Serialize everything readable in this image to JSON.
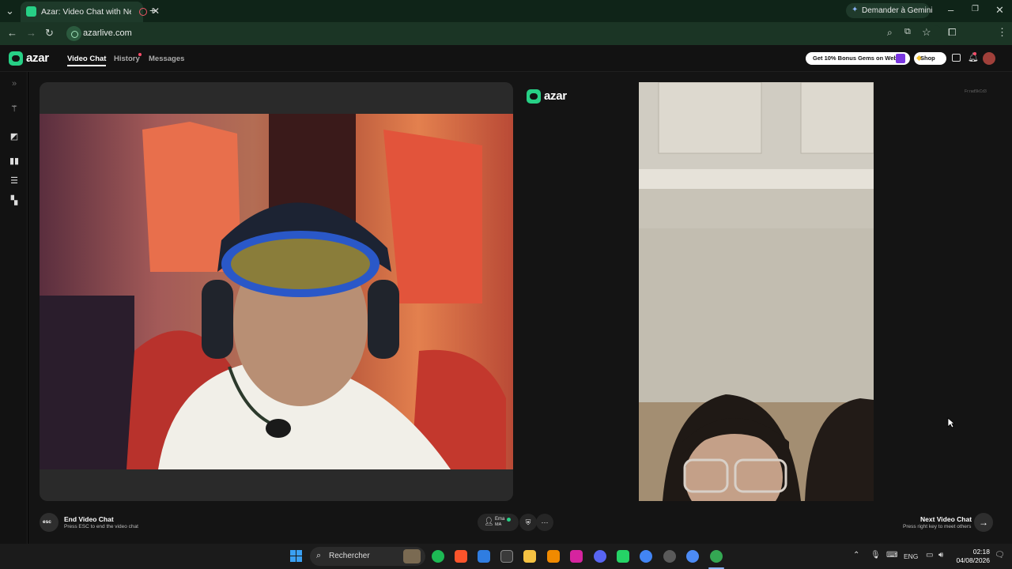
{
  "browser": {
    "tab_title": "Azar: Video Chat with New",
    "url": "azarlive.com",
    "gemini_label": "Demander à Gemini"
  },
  "azar": {
    "logo_text": "azar",
    "nav": {
      "video_chat": "Video Chat",
      "history": "History",
      "messages": "Messages"
    },
    "promo_label": "Get 10% Bonus Gems on Web!",
    "shop_label": "Shop",
    "watermark": "Fr:rad5kCd3"
  },
  "controls": {
    "esc_key": "esc",
    "end_title": "End Video Chat",
    "end_sub": "Press ESC to end the video chat",
    "partner_name": "Ema",
    "partner_country": "MA",
    "next_title": "Next Video Chat",
    "next_sub": "Press right key to meet others"
  },
  "taskbar": {
    "search_placeholder": "Rechercher",
    "lang": "ENG",
    "time": "02:18",
    "date": "04/08/2026"
  },
  "colors": {
    "brand_green": "#27d086",
    "chrome_dark": "#0f2418",
    "chrome_bar": "#1b3525",
    "app_bg": "#141414"
  }
}
